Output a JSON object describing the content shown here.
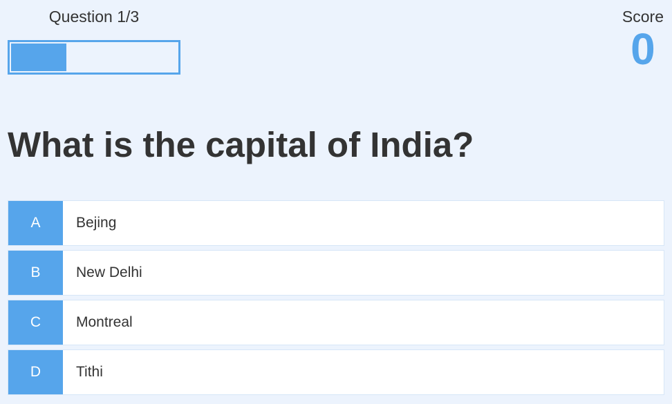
{
  "hud": {
    "question_counter": "Question 1/3",
    "progress_fraction": 0.333,
    "score_label": "Score",
    "score_value": "0"
  },
  "question": {
    "text": "What is the capital of India?"
  },
  "choices": [
    {
      "prefix": "A",
      "text": "Bejing"
    },
    {
      "prefix": "B",
      "text": "New Delhi"
    },
    {
      "prefix": "C",
      "text": "Montreal"
    },
    {
      "prefix": "D",
      "text": "Tithi"
    }
  ],
  "colors": {
    "accent": "#56a5eb",
    "background": "#ecf3fd",
    "text": "#333333"
  }
}
